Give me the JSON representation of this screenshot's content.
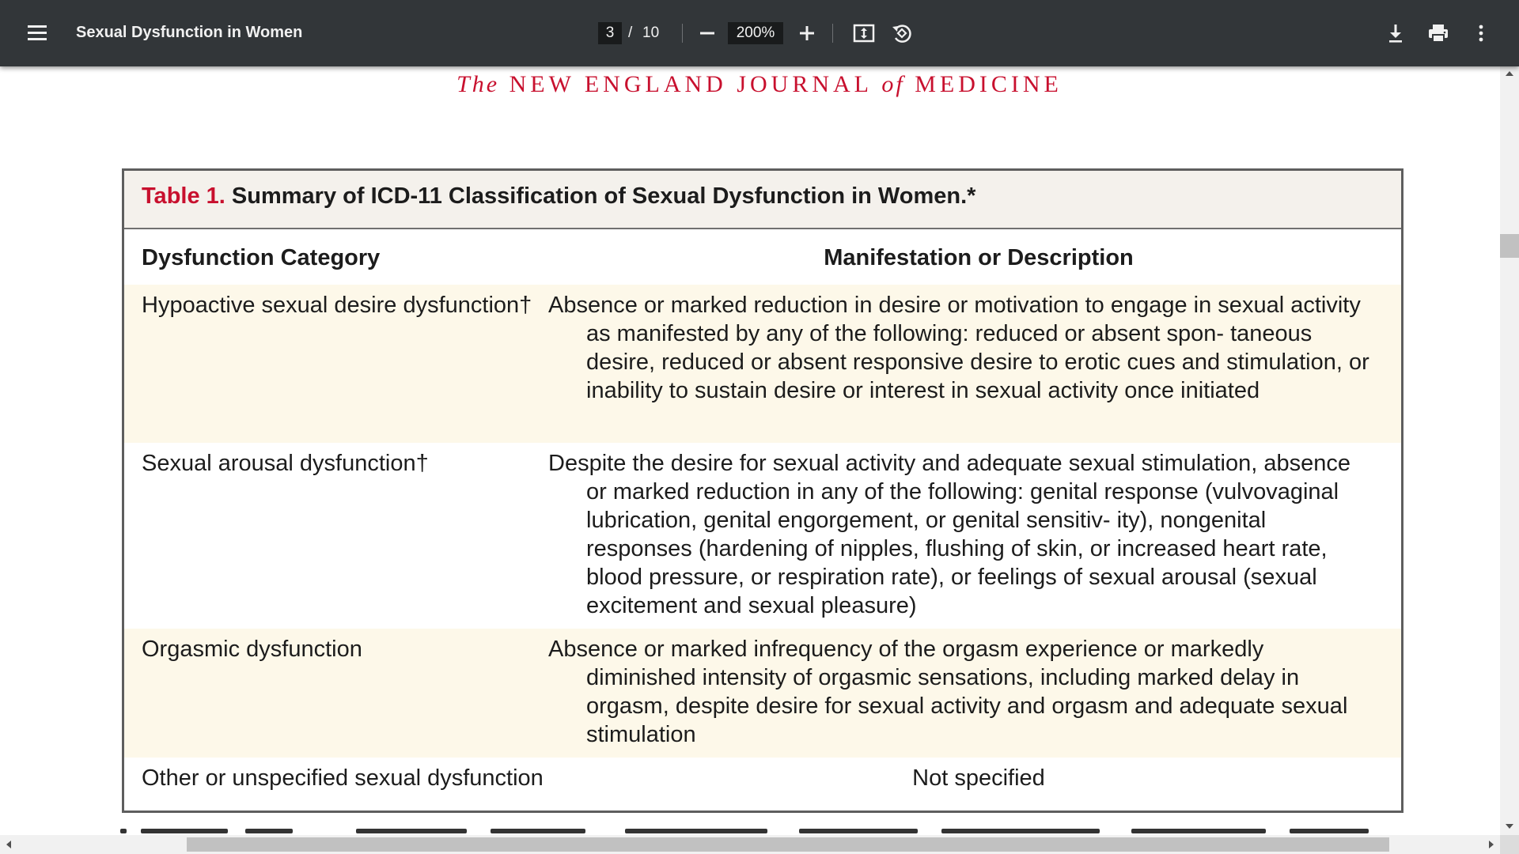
{
  "toolbar": {
    "title": "Sexual Dysfunction in Women",
    "current_page": "3",
    "page_separator": "/",
    "total_pages": "10",
    "zoom": "200%",
    "icons": [
      "menu-icon",
      "zoom-out-icon",
      "zoom-in-icon",
      "fit-page-icon",
      "rotate-icon",
      "download-icon",
      "print-icon",
      "more-options-icon"
    ]
  },
  "document": {
    "journal_header": {
      "pre": "The",
      "mid": "NEW ENGLAND JOURNAL",
      "of": "of",
      "post": "MEDICINE"
    },
    "table": {
      "label": "Table 1.",
      "title": "Summary of ICD-11 Classification of Sexual Dysfunction in Women.*",
      "columns": [
        "Dysfunction Category",
        "Manifestation or Description"
      ],
      "rows": [
        {
          "category": "Hypoactive sexual desire dysfunction†",
          "description": "Absence or marked reduction in desire or motivation to engage in sexual activity as manifested by any of the following: reduced or absent spon- taneous desire, reduced or absent responsive desire to erotic cues and stimulation, or inability to sustain desire or interest in sexual activity once initiated"
        },
        {
          "category": "Sexual arousal dysfunction†",
          "description": "Despite the desire for sexual activity and adequate sexual stimulation, absence or marked reduction in any of the following: genital response (vulvovaginal lubrication, genital engorgement, or genital sensitiv- ity), nongenital responses (hardening of nipples, flushing of skin, or increased heart rate, blood pressure, or respiration rate), or feelings of sexual arousal (sexual excitement and sexual pleasure)"
        },
        {
          "category": "Orgasmic dysfunction",
          "description": "Absence or marked infrequency of the orgasm experience or markedly diminished intensity of orgasmic sensations, including marked delay in orgasm, despite desire for sexual activity and orgasm and adequate sexual stimulation"
        },
        {
          "category": "Other or unspecified sexual dysfunction",
          "description": "Not specified"
        }
      ]
    }
  },
  "colors": {
    "toolbar_bg": "#323639",
    "journal_red": "#c8102e",
    "row_shade": "#fdf8e9",
    "table_header_bg": "#f4f1ec"
  }
}
